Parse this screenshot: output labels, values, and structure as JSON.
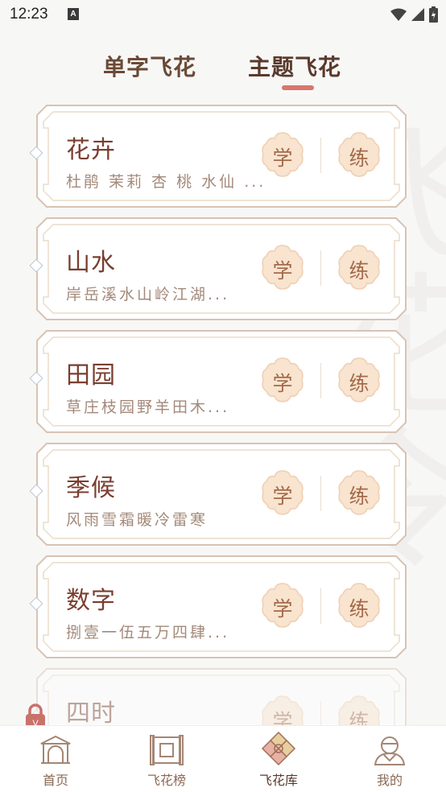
{
  "status_bar": {
    "time": "12:23",
    "notification_icon": "A"
  },
  "tabs": [
    {
      "label": "单字飞花",
      "active": false
    },
    {
      "label": "主题飞花",
      "active": true
    }
  ],
  "watermark": "飞花令",
  "cards": [
    {
      "title": "花卉",
      "subtitle": "杜鹃 茉莉 杏 桃 水仙 ...",
      "learn": "学",
      "practice": "练"
    },
    {
      "title": "山水",
      "subtitle": "岸岳溪水山岭江湖...",
      "learn": "学",
      "practice": "练"
    },
    {
      "title": "田园",
      "subtitle": "草庄枝园野羊田木...",
      "learn": "学",
      "practice": "练"
    },
    {
      "title": "季候",
      "subtitle": "风雨雪霜暖冷雷寒",
      "learn": "学",
      "practice": "练"
    },
    {
      "title": "数字",
      "subtitle": "捌壹一伍五万四肆...",
      "learn": "学",
      "practice": "练"
    },
    {
      "title": "四时",
      "subtitle": "",
      "learn": "学",
      "practice": "练"
    }
  ],
  "bottom_nav": [
    {
      "label": "首页",
      "icon": "home-gate-icon"
    },
    {
      "label": "飞花榜",
      "icon": "scroll-icon"
    },
    {
      "label": "飞花库",
      "icon": "flower-icon",
      "active": true
    },
    {
      "label": "我的",
      "icon": "person-icon"
    }
  ],
  "colors": {
    "accent": "#d9776b",
    "card_border": "#d8c3b3",
    "button_fill": "#f7e4cf",
    "title": "#7a3e2f"
  }
}
